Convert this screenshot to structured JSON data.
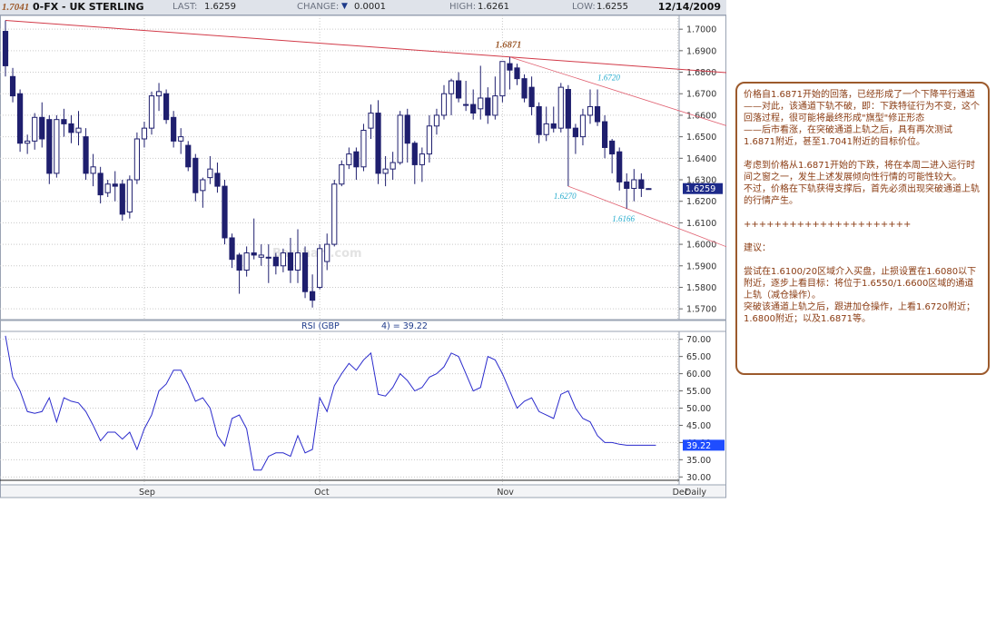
{
  "header": {
    "symbol": "0-FX - UK STERLING",
    "last_label": "LAST:",
    "last": "1.6259",
    "change_label": "CHANGE:",
    "change": "0.0001",
    "high_label": "HIGH:",
    "high": "1.6261",
    "low_label": "LOW:",
    "low": "1.6255",
    "date": "12/14/2009",
    "prev_value": "1.7041"
  },
  "colors": {
    "candle": "#1f1f6e",
    "grid": "#c9c9c9",
    "trendline": "#e06070",
    "annotation_brown": "#9c5a2c",
    "annotation_cyan": "#22aacc",
    "rsi_line": "#2a2acc",
    "price_tag_bg": "#1d2a8a",
    "rsi_tag_bg": "#1f4dff",
    "note_border": "#9c5a2c",
    "note_text": "#8a3b12"
  },
  "chart_data": [
    {
      "type": "candlestick",
      "ylim": [
        1.565,
        1.7064
      ],
      "yticks": [
        "1.7000",
        "1.6900",
        "1.6800",
        "1.6700",
        "1.6600",
        "1.6500",
        "1.6400",
        "1.6300",
        "1.6200",
        "1.6100",
        "1.6000",
        "1.5900",
        "1.5800",
        "1.5700"
      ],
      "ytick_values": [
        1.7,
        1.69,
        1.68,
        1.67,
        1.66,
        1.65,
        1.64,
        1.63,
        1.62,
        1.61,
        1.6,
        1.59,
        1.58,
        1.57
      ],
      "xlabels": [
        "Sep",
        "Oct",
        "Nov",
        "Dec",
        "Daily"
      ],
      "x_date_labels": [
        "Sep",
        "Oct",
        "Nov",
        "Dec"
      ],
      "x_date_label_index": [
        19,
        43,
        68,
        92
      ],
      "x_freq_label": "Daily",
      "last_price": "1.6259",
      "watermark": "Barchart.com",
      "candles": [
        {
          "o": 1.699,
          "h": 1.7041,
          "c": 1.683,
          "l": 1.678
        },
        {
          "o": 1.678,
          "h": 1.682,
          "c": 1.669,
          "l": 1.666
        },
        {
          "o": 1.67,
          "h": 1.672,
          "c": 1.647,
          "l": 1.643
        },
        {
          "o": 1.647,
          "h": 1.651,
          "c": 1.648,
          "l": 1.642
        },
        {
          "o": 1.648,
          "h": 1.661,
          "c": 1.659,
          "l": 1.644
        },
        {
          "o": 1.659,
          "h": 1.666,
          "c": 1.649,
          "l": 1.645
        },
        {
          "o": 1.658,
          "h": 1.66,
          "c": 1.633,
          "l": 1.628
        },
        {
          "o": 1.633,
          "h": 1.66,
          "c": 1.658,
          "l": 1.631
        },
        {
          "o": 1.658,
          "h": 1.663,
          "c": 1.656,
          "l": 1.65
        },
        {
          "o": 1.656,
          "h": 1.66,
          "c": 1.652,
          "l": 1.647
        },
        {
          "o": 1.652,
          "h": 1.662,
          "c": 1.654,
          "l": 1.646
        },
        {
          "o": 1.65,
          "h": 1.654,
          "c": 1.633,
          "l": 1.63
        },
        {
          "o": 1.633,
          "h": 1.642,
          "c": 1.636,
          "l": 1.627
        },
        {
          "o": 1.633,
          "h": 1.636,
          "c": 1.623,
          "l": 1.619
        },
        {
          "o": 1.624,
          "h": 1.63,
          "c": 1.628,
          "l": 1.622
        },
        {
          "o": 1.628,
          "h": 1.634,
          "c": 1.627,
          "l": 1.62
        },
        {
          "o": 1.628,
          "h": 1.63,
          "c": 1.614,
          "l": 1.611
        },
        {
          "o": 1.615,
          "h": 1.632,
          "c": 1.63,
          "l": 1.612
        },
        {
          "o": 1.63,
          "h": 1.652,
          "c": 1.649,
          "l": 1.628
        },
        {
          "o": 1.649,
          "h": 1.657,
          "c": 1.654,
          "l": 1.645
        },
        {
          "o": 1.654,
          "h": 1.671,
          "c": 1.669,
          "l": 1.651
        },
        {
          "o": 1.669,
          "h": 1.675,
          "c": 1.671,
          "l": 1.662
        },
        {
          "o": 1.67,
          "h": 1.672,
          "c": 1.658,
          "l": 1.656
        },
        {
          "o": 1.659,
          "h": 1.662,
          "c": 1.648,
          "l": 1.645
        },
        {
          "o": 1.648,
          "h": 1.654,
          "c": 1.65,
          "l": 1.642
        },
        {
          "o": 1.646,
          "h": 1.648,
          "c": 1.636,
          "l": 1.634
        },
        {
          "o": 1.64,
          "h": 1.642,
          "c": 1.624,
          "l": 1.62
        },
        {
          "o": 1.625,
          "h": 1.631,
          "c": 1.63,
          "l": 1.617
        },
        {
          "o": 1.631,
          "h": 1.641,
          "c": 1.635,
          "l": 1.628
        },
        {
          "o": 1.633,
          "h": 1.638,
          "c": 1.627,
          "l": 1.624
        },
        {
          "o": 1.627,
          "h": 1.63,
          "c": 1.603,
          "l": 1.6
        },
        {
          "o": 1.603,
          "h": 1.605,
          "c": 1.593,
          "l": 1.589
        },
        {
          "o": 1.595,
          "h": 1.596,
          "c": 1.588,
          "l": 1.577
        },
        {
          "o": 1.588,
          "h": 1.599,
          "c": 1.596,
          "l": 1.585
        },
        {
          "o": 1.596,
          "h": 1.612,
          "c": 1.595,
          "l": 1.593
        },
        {
          "o": 1.594,
          "h": 1.6,
          "c": 1.595,
          "l": 1.59
        },
        {
          "o": 1.594,
          "h": 1.6,
          "c": 1.594,
          "l": 1.582
        },
        {
          "o": 1.594,
          "h": 1.596,
          "c": 1.59,
          "l": 1.586
        },
        {
          "o": 1.59,
          "h": 1.598,
          "c": 1.596,
          "l": 1.587
        },
        {
          "o": 1.596,
          "h": 1.603,
          "c": 1.588,
          "l": 1.582
        },
        {
          "o": 1.588,
          "h": 1.607,
          "c": 1.596,
          "l": 1.582
        },
        {
          "o": 1.596,
          "h": 1.599,
          "c": 1.578,
          "l": 1.575
        },
        {
          "o": 1.578,
          "h": 1.586,
          "c": 1.574,
          "l": 1.5706
        },
        {
          "o": 1.58,
          "h": 1.6,
          "c": 1.598,
          "l": 1.579
        },
        {
          "o": 1.592,
          "h": 1.605,
          "c": 1.6,
          "l": 1.588
        },
        {
          "o": 1.6,
          "h": 1.63,
          "c": 1.628,
          "l": 1.599
        },
        {
          "o": 1.628,
          "h": 1.639,
          "c": 1.637,
          "l": 1.627
        },
        {
          "o": 1.637,
          "h": 1.645,
          "c": 1.642,
          "l": 1.635
        },
        {
          "o": 1.643,
          "h": 1.645,
          "c": 1.636,
          "l": 1.63
        },
        {
          "o": 1.636,
          "h": 1.656,
          "c": 1.653,
          "l": 1.634
        },
        {
          "o": 1.654,
          "h": 1.665,
          "c": 1.661,
          "l": 1.649
        },
        {
          "o": 1.661,
          "h": 1.667,
          "c": 1.633,
          "l": 1.628
        },
        {
          "o": 1.633,
          "h": 1.641,
          "c": 1.635,
          "l": 1.627
        },
        {
          "o": 1.635,
          "h": 1.643,
          "c": 1.638,
          "l": 1.63
        },
        {
          "o": 1.638,
          "h": 1.662,
          "c": 1.66,
          "l": 1.637
        },
        {
          "o": 1.66,
          "h": 1.663,
          "c": 1.647,
          "l": 1.638
        },
        {
          "o": 1.647,
          "h": 1.648,
          "c": 1.637,
          "l": 1.628
        },
        {
          "o": 1.637,
          "h": 1.645,
          "c": 1.642,
          "l": 1.629
        },
        {
          "o": 1.642,
          "h": 1.66,
          "c": 1.655,
          "l": 1.638
        },
        {
          "o": 1.655,
          "h": 1.663,
          "c": 1.66,
          "l": 1.651
        },
        {
          "o": 1.66,
          "h": 1.674,
          "c": 1.67,
          "l": 1.658
        },
        {
          "o": 1.67,
          "h": 1.677,
          "c": 1.676,
          "l": 1.66
        },
        {
          "o": 1.676,
          "h": 1.68,
          "c": 1.668,
          "l": 1.666
        },
        {
          "o": 1.665,
          "h": 1.676,
          "c": 1.665,
          "l": 1.662
        },
        {
          "o": 1.665,
          "h": 1.672,
          "c": 1.661,
          "l": 1.658
        },
        {
          "o": 1.663,
          "h": 1.683,
          "c": 1.668,
          "l": 1.658
        },
        {
          "o": 1.668,
          "h": 1.673,
          "c": 1.66,
          "l": 1.656
        },
        {
          "o": 1.66,
          "h": 1.678,
          "c": 1.669,
          "l": 1.658
        },
        {
          "o": 1.669,
          "h": 1.68,
          "c": 1.685,
          "l": 1.666
        },
        {
          "o": 1.684,
          "h": 1.6871,
          "c": 1.681,
          "l": 1.672
        },
        {
          "o": 1.682,
          "h": 1.684,
          "c": 1.677,
          "l": 1.674
        },
        {
          "o": 1.677,
          "h": 1.679,
          "c": 1.668,
          "l": 1.666
        },
        {
          "o": 1.673,
          "h": 1.678,
          "c": 1.664,
          "l": 1.66
        },
        {
          "o": 1.664,
          "h": 1.666,
          "c": 1.651,
          "l": 1.647
        },
        {
          "o": 1.651,
          "h": 1.664,
          "c": 1.656,
          "l": 1.648
        },
        {
          "o": 1.656,
          "h": 1.664,
          "c": 1.654,
          "l": 1.652
        },
        {
          "o": 1.654,
          "h": 1.675,
          "c": 1.673,
          "l": 1.652
        },
        {
          "o": 1.672,
          "h": 1.674,
          "c": 1.654,
          "l": 1.627
        },
        {
          "o": 1.654,
          "h": 1.656,
          "c": 1.65,
          "l": 1.642
        },
        {
          "o": 1.65,
          "h": 1.663,
          "c": 1.66,
          "l": 1.646
        },
        {
          "o": 1.66,
          "h": 1.672,
          "c": 1.664,
          "l": 1.656
        },
        {
          "o": 1.664,
          "h": 1.672,
          "c": 1.657,
          "l": 1.655
        },
        {
          "o": 1.657,
          "h": 1.66,
          "c": 1.645,
          "l": 1.64
        },
        {
          "o": 1.648,
          "h": 1.649,
          "c": 1.642,
          "l": 1.633
        },
        {
          "o": 1.643,
          "h": 1.645,
          "c": 1.629,
          "l": 1.625
        },
        {
          "o": 1.629,
          "h": 1.633,
          "c": 1.626,
          "l": 1.6166
        },
        {
          "o": 1.626,
          "h": 1.635,
          "c": 1.63,
          "l": 1.62
        },
        {
          "o": 1.63,
          "h": 1.633,
          "c": 1.626,
          "l": 1.622
        },
        {
          "o": 1.6255,
          "h": 1.6261,
          "c": 1.6259,
          "l": 1.6255
        }
      ],
      "annotations": [
        {
          "label": "1.6871",
          "index": 69,
          "price": 1.6871,
          "style": "brown"
        },
        {
          "label": "1.6720",
          "index": 83,
          "price": 1.672,
          "style": "cyan"
        },
        {
          "label": "1.6270",
          "index": 77,
          "price": 1.627,
          "style": "cyan"
        },
        {
          "label": "1.6166",
          "index": 85,
          "price": 1.6166,
          "style": "cyan"
        },
        {
          "label": "1.5706",
          "index": 41,
          "price": 1.5706,
          "style": "brown"
        }
      ]
    },
    {
      "type": "line",
      "title": "RSI (GBP",
      "title_suffix": "4) = 39.22",
      "last_value": "39.22",
      "ylim": [
        28.5,
        71.5
      ],
      "yticks": [
        "70.00",
        "65.00",
        "60.00",
        "55.00",
        "50.00",
        "45.00",
        "40.00",
        "35.00",
        "30.00"
      ],
      "ytick_values": [
        70,
        65,
        60,
        55,
        50,
        45,
        40,
        35,
        30
      ],
      "x": [
        0,
        1,
        2,
        3,
        4,
        5,
        6,
        7,
        8,
        9,
        10,
        11,
        12,
        13,
        14,
        15,
        16,
        17,
        18,
        19,
        20,
        21,
        22,
        23,
        24,
        25,
        26,
        27,
        28,
        29,
        30,
        31,
        32,
        33,
        34,
        35,
        36,
        37,
        38,
        39,
        40,
        41,
        42,
        43,
        44,
        45,
        46,
        47,
        48,
        49,
        50,
        51,
        52,
        53,
        54,
        55,
        56,
        57,
        58,
        59,
        60,
        61,
        62,
        63,
        64,
        65,
        66,
        67,
        68,
        69,
        70,
        71,
        72,
        73,
        74,
        75,
        76,
        77,
        78,
        79,
        80,
        81,
        82,
        83,
        84,
        85,
        86,
        87,
        88,
        89
      ],
      "values": [
        71,
        59,
        55,
        49,
        48.5,
        49,
        53,
        46,
        53,
        52,
        51.5,
        49,
        45,
        40.5,
        43,
        43,
        41,
        43,
        38,
        44,
        48,
        55,
        57,
        61,
        61,
        57,
        52,
        53,
        50,
        42,
        39,
        47,
        48,
        44,
        32,
        32,
        36,
        37,
        37,
        36,
        42,
        37,
        38,
        53,
        49,
        56.5,
        60,
        63,
        61,
        64,
        66,
        54,
        53.5,
        56,
        60,
        58,
        55,
        56,
        59,
        60,
        62,
        66,
        65,
        60,
        55,
        56,
        65,
        64,
        60,
        55,
        50,
        52,
        53,
        49,
        48,
        47,
        54,
        55,
        50,
        47,
        46,
        42,
        40,
        40,
        39.5,
        39.22,
        39.22,
        39.22,
        39.22,
        39.22
      ]
    }
  ],
  "note": {
    "p1": "价格自1.6871开始的回落，已经形成了一个下降平行通道",
    "p2": "——对此，该通道下轨不破，即：下跌特征行为不变，这个回落过程，很可能将最终形成\"旗型\"修正形态",
    "p3": "——后市看涨，在突破通道上轨之后，具有再次测试1.6871附近，甚至1.7041附近的目标价位。",
    "p4": "考虑到价格从1.6871开始的下跌，将在本周二进入运行时间之窗之一，发生上述发展倾向性行情的可能性较大。",
    "p5": "不过，价格在下轨获得支撑后，首先必须出现突破通道上轨的行情产生。",
    "divider": "++++++++++++++++++++++",
    "p6": "建议：",
    "p7": "尝试在1.6100/20区域介入买盘，止损设置在1.6080以下附近，逐步上看目标：将位于1.6550/1.6600区域的通道上轨（减仓操作）。",
    "p8": "突破该通道上轨之后，跟进加仓操作，上看1.6720附近；1.6800附近；以及1.6871等。"
  }
}
